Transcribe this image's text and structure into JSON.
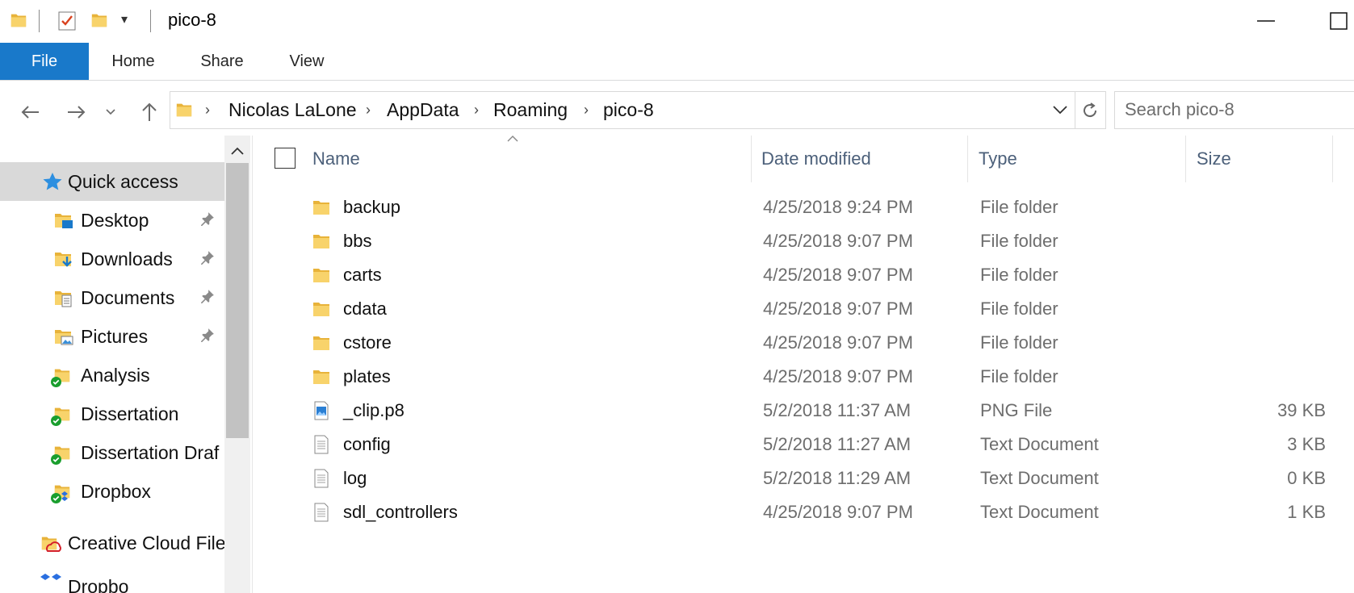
{
  "window": {
    "title": "pico-8"
  },
  "ribbon": {
    "tabs": [
      {
        "label": "File"
      },
      {
        "label": "Home"
      },
      {
        "label": "Share"
      },
      {
        "label": "View"
      }
    ]
  },
  "address": {
    "crumbs": [
      "Nicolas LaLone",
      "AppData",
      "Roaming",
      "pico-8"
    ]
  },
  "search": {
    "placeholder": "Search pico-8"
  },
  "nav": {
    "items": [
      {
        "label": "Quick access",
        "icon": "star-icon"
      },
      {
        "label": "Desktop",
        "icon": "desktop-folder-icon",
        "pinned": true
      },
      {
        "label": "Downloads",
        "icon": "downloads-folder-icon",
        "pinned": true
      },
      {
        "label": "Documents",
        "icon": "documents-folder-icon",
        "pinned": true
      },
      {
        "label": "Pictures",
        "icon": "pictures-folder-icon",
        "pinned": true
      },
      {
        "label": "Analysis",
        "icon": "synced-folder-icon"
      },
      {
        "label": "Dissertation",
        "icon": "synced-folder-icon"
      },
      {
        "label": "Dissertation Draf",
        "icon": "synced-folder-icon"
      },
      {
        "label": "Dropbox",
        "icon": "dropbox-folder-icon"
      },
      {
        "label": "Creative Cloud File",
        "icon": "creative-cloud-folder-icon"
      },
      {
        "label": "Dropbo",
        "icon": "dropbox-icon"
      }
    ]
  },
  "list": {
    "columns": [
      "Name",
      "Date modified",
      "Type",
      "Size"
    ],
    "rows": [
      {
        "name": "backup",
        "date": "4/25/2018 9:24 PM",
        "type": "File folder",
        "size": "",
        "icon": "folder-icon"
      },
      {
        "name": "bbs",
        "date": "4/25/2018 9:07 PM",
        "type": "File folder",
        "size": "",
        "icon": "folder-icon"
      },
      {
        "name": "carts",
        "date": "4/25/2018 9:07 PM",
        "type": "File folder",
        "size": "",
        "icon": "folder-icon"
      },
      {
        "name": "cdata",
        "date": "4/25/2018 9:07 PM",
        "type": "File folder",
        "size": "",
        "icon": "folder-icon"
      },
      {
        "name": "cstore",
        "date": "4/25/2018 9:07 PM",
        "type": "File folder",
        "size": "",
        "icon": "folder-icon"
      },
      {
        "name": "plates",
        "date": "4/25/2018 9:07 PM",
        "type": "File folder",
        "size": "",
        "icon": "folder-icon"
      },
      {
        "name": "_clip.p8",
        "date": "5/2/2018 11:37 AM",
        "type": "PNG File",
        "size": "39 KB",
        "icon": "image-file-icon"
      },
      {
        "name": "config",
        "date": "5/2/2018 11:27 AM",
        "type": "Text Document",
        "size": "3 KB",
        "icon": "text-file-icon"
      },
      {
        "name": "log",
        "date": "5/2/2018 11:29 AM",
        "type": "Text Document",
        "size": "0 KB",
        "icon": "text-file-icon"
      },
      {
        "name": "sdl_controllers",
        "date": "4/25/2018 9:07 PM",
        "type": "Text Document",
        "size": "1 KB",
        "icon": "text-file-icon"
      }
    ]
  },
  "colors": {
    "accent": "#1979ca",
    "folder": "#f6c84a",
    "header_text": "#4c607a",
    "selected_bg": "#d9d9d9"
  }
}
